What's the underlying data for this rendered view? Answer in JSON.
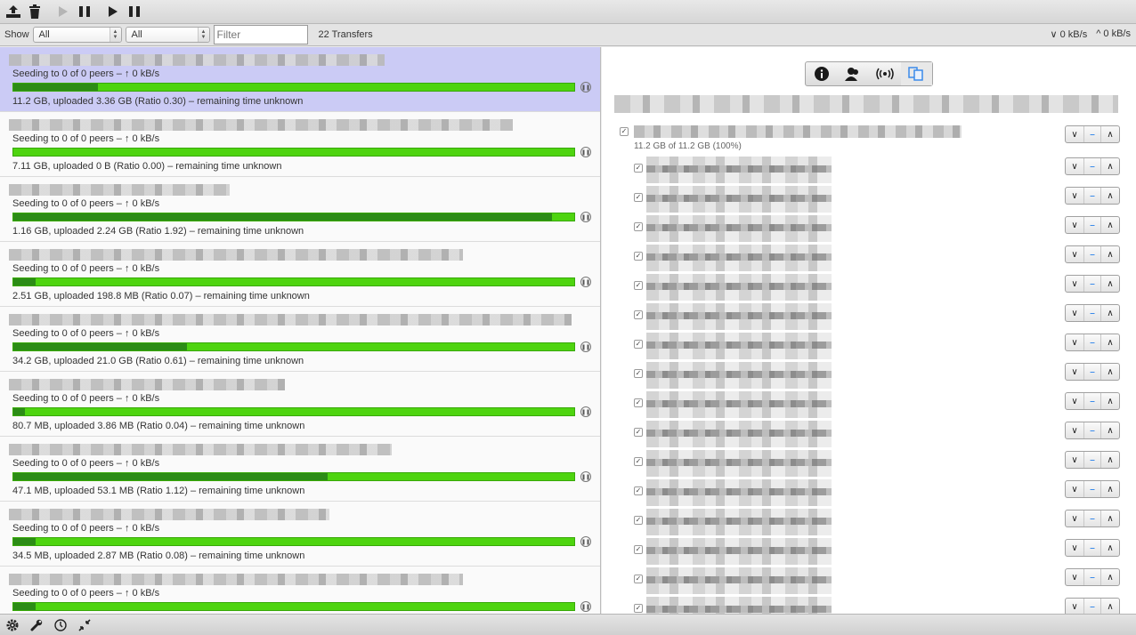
{
  "toolbar": {
    "buttons": [
      {
        "icon": "open-torrent-icon"
      },
      {
        "icon": "remove-icon"
      },
      {
        "icon": "resume-selected-icon"
      },
      {
        "icon": "pause-selected-icon"
      },
      {
        "icon": "resume-all-icon"
      },
      {
        "icon": "pause-all-icon"
      }
    ]
  },
  "filterbar": {
    "show_label": "Show",
    "status_filter": "All",
    "group_filter": "All",
    "filter_placeholder": "Filter",
    "transfer_count": "22 Transfers",
    "download_speed": "0 kB/s",
    "upload_speed": "0 kB/s"
  },
  "transfers": [
    {
      "status": "Seeding to 0 of 0 peers – ↑ 0 kB/s",
      "info": "11.2 GB, uploaded 3.36 GB (Ratio 0.30) – remaining time unknown",
      "ratio_fill": 0.15,
      "selected": true
    },
    {
      "status": "Seeding to 0 of 0 peers – ↑ 0 kB/s",
      "info": "7.11 GB, uploaded 0 B (Ratio 0.00) – remaining time unknown",
      "ratio_fill": 0.0,
      "selected": false
    },
    {
      "status": "Seeding to 0 of 0 peers – ↑ 0 kB/s",
      "info": "1.16 GB, uploaded 2.24 GB (Ratio 1.92) – remaining time unknown",
      "ratio_fill": 0.96,
      "selected": false
    },
    {
      "status": "Seeding to 0 of 0 peers – ↑ 0 kB/s",
      "info": "2.51 GB, uploaded 198.8 MB (Ratio 0.07) – remaining time unknown",
      "ratio_fill": 0.04,
      "selected": false
    },
    {
      "status": "Seeding to 0 of 0 peers – ↑ 0 kB/s",
      "info": "34.2 GB, uploaded 21.0 GB (Ratio 0.61) – remaining time unknown",
      "ratio_fill": 0.31,
      "selected": false
    },
    {
      "status": "Seeding to 0 of 0 peers – ↑ 0 kB/s",
      "info": "80.7 MB, uploaded 3.86 MB (Ratio 0.04) – remaining time unknown",
      "ratio_fill": 0.02,
      "selected": false
    },
    {
      "status": "Seeding to 0 of 0 peers – ↑ 0 kB/s",
      "info": "47.1 MB, uploaded 53.1 MB (Ratio 1.12) – remaining time unknown",
      "ratio_fill": 0.56,
      "selected": false
    },
    {
      "status": "Seeding to 0 of 0 peers – ↑ 0 kB/s",
      "info": "34.5 MB, uploaded 2.87 MB (Ratio 0.08) – remaining time unknown",
      "ratio_fill": 0.04,
      "selected": false
    },
    {
      "status": "Seeding to 0 of 0 peers – ↑ 0 kB/s",
      "info": "",
      "ratio_fill": 0.04,
      "selected": false
    }
  ],
  "inspector": {
    "tabs": [
      {
        "icon": "info-icon",
        "active": false
      },
      {
        "icon": "peers-icon",
        "active": false
      },
      {
        "icon": "trackers-icon",
        "active": false
      },
      {
        "icon": "files-icon",
        "active": true
      }
    ],
    "root_size": "11.2 GB of 11.2 GB (100%)",
    "file_count": 16,
    "priority_labels": {
      "low": "∨",
      "normal": "–",
      "high": "∧"
    }
  },
  "bottombar": {
    "buttons": [
      {
        "icon": "gear-icon"
      },
      {
        "icon": "wrench-icon"
      },
      {
        "icon": "speed-limit-icon"
      },
      {
        "icon": "collapse-icon"
      }
    ]
  }
}
